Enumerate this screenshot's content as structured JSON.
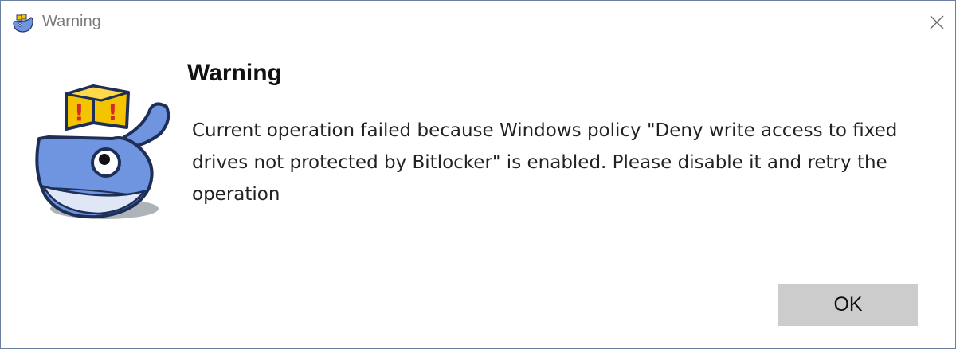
{
  "window": {
    "title": "Warning",
    "title_icon": "docker-whale-icon",
    "close_icon": "close-icon"
  },
  "dialog": {
    "heading": "Warning",
    "message": "Current operation failed because Windows policy \"Deny write access to fixed drives not protected by Bitlocker\" is enabled. Please disable it and retry the operation",
    "mascot_icon": "docker-whale-warning-boxes-icon",
    "box_glyph": "!",
    "ok_label": "OK"
  },
  "colors": {
    "whale_blue": "#6f95e0",
    "whale_belly": "#dfe7f7",
    "box_yellow": "#f5c400",
    "box_exclaim": "#d42a2a",
    "button_gray": "#cccccc",
    "border": "#6b7fa0"
  }
}
